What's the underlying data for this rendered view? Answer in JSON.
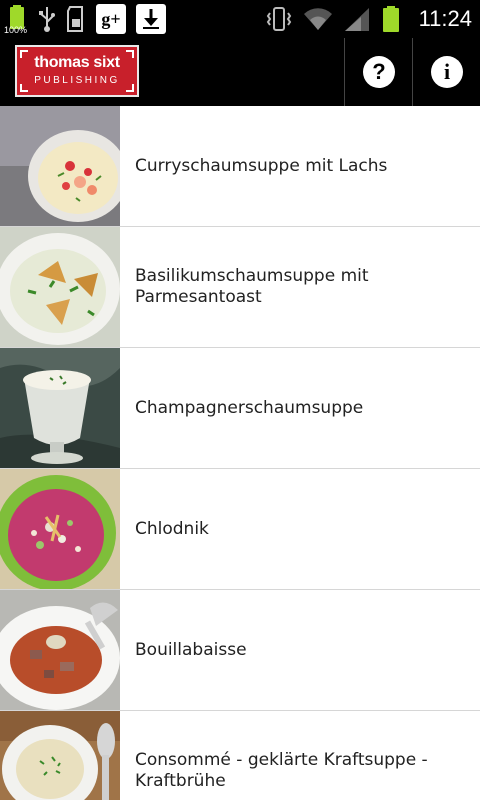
{
  "status_bar": {
    "battery_percent_label": "100%",
    "time": "11:24",
    "left_icons": [
      "battery-icon",
      "usb-icon",
      "sd-card-icon",
      "google-plus-icon",
      "download-icon"
    ],
    "right_icons": [
      "vibrate-icon",
      "wifi-icon",
      "signal-icon",
      "battery-icon"
    ]
  },
  "action_bar": {
    "logo_line1": "thomas sixt",
    "logo_line2": "PUBLISHING",
    "help_glyph": "?",
    "info_glyph": "i",
    "colors": {
      "logo_red": "#c8202b",
      "bar": "#000000"
    }
  },
  "recipes": [
    {
      "title": "Curryschaumsuppe mit Lachs",
      "image": "creamy-soup-with-salmon"
    },
    {
      "title": "Basilikumschaumsuppe mit Parmesantoast",
      "image": "basil-soup-with-toast"
    },
    {
      "title": "Champagnerschaumsuppe",
      "image": "champagne-foam-soup-glass"
    },
    {
      "title": "Chlodnik",
      "image": "pink-beet-soup-green-bowl"
    },
    {
      "title": "Bouillabaisse",
      "image": "fish-soup-white-plate"
    },
    {
      "title": "Consommé - geklärte Kraftsuppe - Kraftbrühe",
      "image": "clear-broth-with-spoon"
    }
  ]
}
